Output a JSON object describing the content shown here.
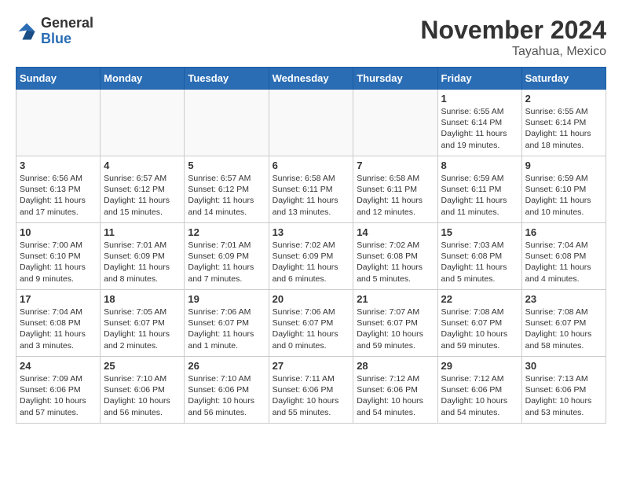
{
  "header": {
    "logo_general": "General",
    "logo_blue": "Blue",
    "month_title": "November 2024",
    "location": "Tayahua, Mexico"
  },
  "weekdays": [
    "Sunday",
    "Monday",
    "Tuesday",
    "Wednesday",
    "Thursday",
    "Friday",
    "Saturday"
  ],
  "weeks": [
    {
      "days": [
        {
          "num": "",
          "detail": ""
        },
        {
          "num": "",
          "detail": ""
        },
        {
          "num": "",
          "detail": ""
        },
        {
          "num": "",
          "detail": ""
        },
        {
          "num": "",
          "detail": ""
        },
        {
          "num": "1",
          "detail": "Sunrise: 6:55 AM\nSunset: 6:14 PM\nDaylight: 11 hours and 19 minutes."
        },
        {
          "num": "2",
          "detail": "Sunrise: 6:55 AM\nSunset: 6:14 PM\nDaylight: 11 hours and 18 minutes."
        }
      ]
    },
    {
      "days": [
        {
          "num": "3",
          "detail": "Sunrise: 6:56 AM\nSunset: 6:13 PM\nDaylight: 11 hours and 17 minutes."
        },
        {
          "num": "4",
          "detail": "Sunrise: 6:57 AM\nSunset: 6:12 PM\nDaylight: 11 hours and 15 minutes."
        },
        {
          "num": "5",
          "detail": "Sunrise: 6:57 AM\nSunset: 6:12 PM\nDaylight: 11 hours and 14 minutes."
        },
        {
          "num": "6",
          "detail": "Sunrise: 6:58 AM\nSunset: 6:11 PM\nDaylight: 11 hours and 13 minutes."
        },
        {
          "num": "7",
          "detail": "Sunrise: 6:58 AM\nSunset: 6:11 PM\nDaylight: 11 hours and 12 minutes."
        },
        {
          "num": "8",
          "detail": "Sunrise: 6:59 AM\nSunset: 6:11 PM\nDaylight: 11 hours and 11 minutes."
        },
        {
          "num": "9",
          "detail": "Sunrise: 6:59 AM\nSunset: 6:10 PM\nDaylight: 11 hours and 10 minutes."
        }
      ]
    },
    {
      "days": [
        {
          "num": "10",
          "detail": "Sunrise: 7:00 AM\nSunset: 6:10 PM\nDaylight: 11 hours and 9 minutes."
        },
        {
          "num": "11",
          "detail": "Sunrise: 7:01 AM\nSunset: 6:09 PM\nDaylight: 11 hours and 8 minutes."
        },
        {
          "num": "12",
          "detail": "Sunrise: 7:01 AM\nSunset: 6:09 PM\nDaylight: 11 hours and 7 minutes."
        },
        {
          "num": "13",
          "detail": "Sunrise: 7:02 AM\nSunset: 6:09 PM\nDaylight: 11 hours and 6 minutes."
        },
        {
          "num": "14",
          "detail": "Sunrise: 7:02 AM\nSunset: 6:08 PM\nDaylight: 11 hours and 5 minutes."
        },
        {
          "num": "15",
          "detail": "Sunrise: 7:03 AM\nSunset: 6:08 PM\nDaylight: 11 hours and 5 minutes."
        },
        {
          "num": "16",
          "detail": "Sunrise: 7:04 AM\nSunset: 6:08 PM\nDaylight: 11 hours and 4 minutes."
        }
      ]
    },
    {
      "days": [
        {
          "num": "17",
          "detail": "Sunrise: 7:04 AM\nSunset: 6:08 PM\nDaylight: 11 hours and 3 minutes."
        },
        {
          "num": "18",
          "detail": "Sunrise: 7:05 AM\nSunset: 6:07 PM\nDaylight: 11 hours and 2 minutes."
        },
        {
          "num": "19",
          "detail": "Sunrise: 7:06 AM\nSunset: 6:07 PM\nDaylight: 11 hours and 1 minute."
        },
        {
          "num": "20",
          "detail": "Sunrise: 7:06 AM\nSunset: 6:07 PM\nDaylight: 11 hours and 0 minutes."
        },
        {
          "num": "21",
          "detail": "Sunrise: 7:07 AM\nSunset: 6:07 PM\nDaylight: 10 hours and 59 minutes."
        },
        {
          "num": "22",
          "detail": "Sunrise: 7:08 AM\nSunset: 6:07 PM\nDaylight: 10 hours and 59 minutes."
        },
        {
          "num": "23",
          "detail": "Sunrise: 7:08 AM\nSunset: 6:07 PM\nDaylight: 10 hours and 58 minutes."
        }
      ]
    },
    {
      "days": [
        {
          "num": "24",
          "detail": "Sunrise: 7:09 AM\nSunset: 6:06 PM\nDaylight: 10 hours and 57 minutes."
        },
        {
          "num": "25",
          "detail": "Sunrise: 7:10 AM\nSunset: 6:06 PM\nDaylight: 10 hours and 56 minutes."
        },
        {
          "num": "26",
          "detail": "Sunrise: 7:10 AM\nSunset: 6:06 PM\nDaylight: 10 hours and 56 minutes."
        },
        {
          "num": "27",
          "detail": "Sunrise: 7:11 AM\nSunset: 6:06 PM\nDaylight: 10 hours and 55 minutes."
        },
        {
          "num": "28",
          "detail": "Sunrise: 7:12 AM\nSunset: 6:06 PM\nDaylight: 10 hours and 54 minutes."
        },
        {
          "num": "29",
          "detail": "Sunrise: 7:12 AM\nSunset: 6:06 PM\nDaylight: 10 hours and 54 minutes."
        },
        {
          "num": "30",
          "detail": "Sunrise: 7:13 AM\nSunset: 6:06 PM\nDaylight: 10 hours and 53 minutes."
        }
      ]
    }
  ]
}
